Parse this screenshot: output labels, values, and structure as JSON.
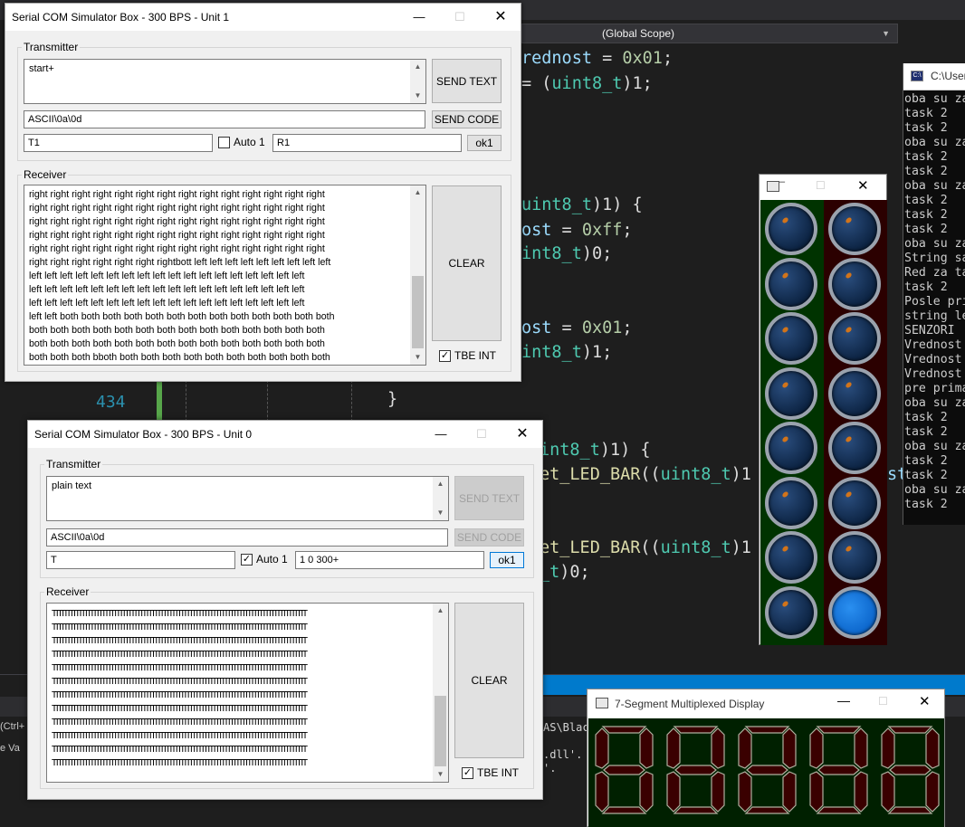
{
  "ide": {
    "scope": "(Global Scope)",
    "line_number": "434",
    "code_lines": [
      {
        "parts": [
          [
            "rednost",
            "ident"
          ],
          [
            " = ",
            "plain"
          ],
          [
            "0x01",
            "num"
          ],
          [
            ";",
            "plain"
          ]
        ]
      },
      {
        "parts": [
          [
            "= (",
            "plain"
          ],
          [
            "uint8_t",
            "type"
          ],
          [
            ")1;",
            "plain"
          ]
        ]
      },
      {
        "parts": [
          [
            "uint8_t",
            "type"
          ],
          [
            ")1) {",
            "plain"
          ]
        ]
      },
      {
        "parts": [
          [
            "ost",
            "ident"
          ],
          [
            " = ",
            "plain"
          ],
          [
            "0xff",
            "num"
          ],
          [
            ";",
            "plain"
          ]
        ]
      },
      {
        "parts": [
          [
            "int8_t",
            "type"
          ],
          [
            ")0;",
            "plain"
          ]
        ]
      },
      {
        "parts": [
          [
            "ost",
            "ident"
          ],
          [
            " = ",
            "plain"
          ],
          [
            "0x01",
            "num"
          ],
          [
            ";",
            "plain"
          ]
        ]
      },
      {
        "parts": [
          [
            "int8_t",
            "type"
          ],
          [
            ")1;",
            "plain"
          ]
        ]
      },
      {
        "parts": [
          [
            "}",
            "plain"
          ]
        ]
      },
      {
        "parts": [
          [
            "int8_t",
            "type"
          ],
          [
            ")1) {",
            "plain"
          ]
        ]
      },
      {
        "parts": [
          [
            "et_LED_BAR",
            "fn"
          ],
          [
            "((",
            "plain"
          ],
          [
            "uint8_t",
            "type"
          ],
          [
            ")1",
            "plain"
          ]
        ]
      },
      {
        "parts": [
          [
            "et_LED_BAR",
            "fn"
          ],
          [
            "((",
            "plain"
          ],
          [
            "uint8_t",
            "type"
          ],
          [
            ")1",
            "plain"
          ]
        ]
      },
      {
        "parts": [
          [
            "_t",
            "type"
          ],
          [
            ")0;",
            "plain"
          ]
        ]
      }
    ],
    "bottom_snippets": [
      "AS\\Blac",
      ".dll'.",
      "'."
    ],
    "left_snippets": [
      "(Ctrl+",
      "e   Va"
    ]
  },
  "console": {
    "title": "C:\\User",
    "lines": [
      "oba su za",
      "task 2",
      "task 2",
      "oba su za",
      "task 2",
      "task 2",
      "oba su za",
      "task 2",
      "task 2",
      "task 2",
      "oba su za",
      "String sa",
      "Red za ta",
      "task 2",
      "Posle pri",
      "string le",
      "SENZORI",
      "Vrednost",
      "Vrednost",
      "Vrednost",
      "pre prima",
      "oba su za",
      "task 2",
      "task 2",
      "oba su za",
      "task 2",
      "task 2",
      "oba su za",
      "task 2"
    ]
  },
  "unit1": {
    "title": "Serial COM Simulator Box - 300 BPS - Unit 1",
    "transmitter_label": "Transmitter",
    "tx_text": "start+",
    "send_text": "SEND TEXT",
    "code_field": "ASCII\\0a\\0d",
    "send_code": "SEND CODE",
    "t_field": "T1",
    "auto_label": "Auto 1",
    "auto_checked": false,
    "r_field": "R1",
    "ok_label": "ok1",
    "receiver_label": "Receiver",
    "rx_text": "right right right right right right right right right right right right right right\nright right right right right right right right right right right right right right\nright right right right right right right right right right right right right right\nright right right right right right right right right right right right right right\nright right right right right right right right right right right right right right\nright right right right right right rightbott left left left left left left left left left\nleft left left left left left left left left left left left left left left left left left\nleft left left left left left left left left left left left left left left left left left\nleft left left left left left left left left left left left left left left left left left\nleft left both both both both both both both both both both both both both\nboth both both both both both both both both both both both both both\nboth both both both both both both both both both both both both both\nboth both both bboth both both both both both both both both both both\nboth both both both both both both",
    "clear": "CLEAR",
    "tbe_label": "TBE INT",
    "tbe_checked": true
  },
  "unit0": {
    "title": "Serial COM Simulator Box - 300 BPS - Unit 0",
    "transmitter_label": "Transmitter",
    "tx_text": "plain text",
    "send_text": "SEND TEXT",
    "code_field": "ASCII\\0a\\0d",
    "send_code": "SEND CODE",
    "t_field": "T",
    "auto_label": "Auto 1",
    "auto_checked": true,
    "r_field": "1 0 300+",
    "ok_label": "ok1",
    "receiver_label": "Receiver",
    "rx_rows": [
      "TTTTTTTTTTTTTTTTTTTTTTTTTTTTTTTTTTTTTTTTTTTTTTTTTTTTTTTTTTTTTTTTTTTTTTTTTTTTTTTTTTTTTTT",
      "TTTTTTTTTTTTTTTTTTTTTTTTTTTTTTTTTTTTTTTTTTTTTTTTTTTTTTTTTTTTTTTTTTTTTTTTTTTTTTTTTTTTTTT",
      "TTTTTTTTTTTTTTTTTTTTTTTTTTTTTTTTTTTTTTTTTTTTTTTTTTTTTTTTTTTTTTTTTTTTTTTTTTTTTTTTTTTTTTT",
      "TTTTTTTTTTTTTTTTTTTTTTTTTTTTTTTTTTTTTTTTTTTTTTTTTTTTTTTTTTTTTTTTTTTTTTTTTTTTTTTTTTTTTTT",
      "TTTTTTTTTTTTTTTTTTTTTTTTTTTTTTTTTTTTTTTTTTTTTTTTTTTTTTTTTTTTTTTTTTTTTTTTTTTTTTTTTTTTTTT",
      "TTTTTTTTTTTTTTTTTTTTTTTTTTTTTTTTTTTTTTTTTTTTTTTTTTTTTTTTTTTTTTTTTTTTTTTTTTTTTTTTTTTTTTT",
      "TTTTTTTTTTTTTTTTTTTTTTTTTTTTTTTTTTTTTTTTTTTTTTTTTTTTTTTTTTTTTTTTTTTTTTTTTTTTTTTTTTTTTTT",
      "TTTTTTTTTTTTTTTTTTTTTTTTTTTTTTTTTTTTTTTTTTTTTTTTTTTTTTTTTTTTTTTTTTTTTTTTTTTTTTTTTTTTTTT",
      "TTTTTTTTTTTTTTTTTTTTTTTTTTTTTTTTTTTTTTTTTTTTTTTTTTTTTTTTTTTTTTTTTTTTTTTTTTTTTTTTTTTTTTT",
      "TTTTTTTTTTTTTTTTTTTTTTTTTTTTTTTTTTTTTTTTTTTTTTTTTTTTTTTTTTTTTTTTTTTTTTTTTTTTTTTTTTTTTTT",
      "TTTTTTTTTTTTTTTTTTTTTTTTTTTTTTTTTTTTTTTTTTTTTTTTTTTTTTTTTTTTTTTTTTTTTTTTTTTTTTTTTTTTTTT",
      "TTTTTTTTTTTTTTTTTTTTTTTTTTTTTTTTTTTTTTTTTTTTTTTTTTTTTTTTTTTTTTTTTTTTTTTTTTTTTTTTTTTTTTT"
    ],
    "clear": "CLEAR",
    "tbe_label": "TBE INT",
    "tbe_checked": true
  },
  "led_bar": {
    "left_states": [
      false,
      false,
      false,
      false,
      false,
      false,
      false,
      false
    ],
    "right_states": [
      false,
      false,
      false,
      false,
      false,
      false,
      false,
      true
    ],
    "left_bg": "#003300",
    "right_bg": "#2b0000",
    "on_color": "#0a63c9"
  },
  "seven_segment": {
    "title": "7-Segment Multiplexed Display",
    "digit_count": 5,
    "segment_off_color": "#3a0000",
    "segment_outline": "#b0b0a0"
  },
  "colors": {
    "ide_bg": "#1e1e1e",
    "accent_blue": "#007acc"
  }
}
